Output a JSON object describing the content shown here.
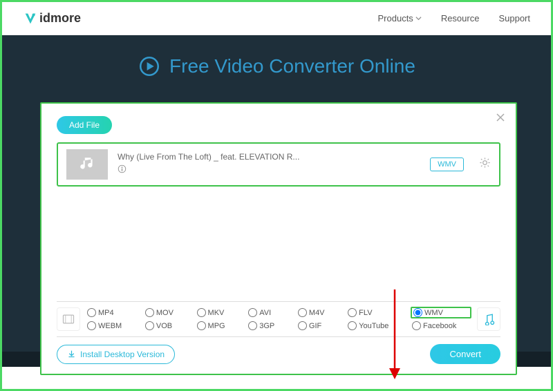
{
  "brand": "idmore",
  "nav": {
    "products": "Products",
    "resource": "Resource",
    "support": "Support"
  },
  "hero": {
    "title": "Free Video Converter Online"
  },
  "modal": {
    "add_file": "Add File",
    "file": {
      "name": "Why (Live From The Loft) _ feat. ELEVATION R...",
      "badge": "WMV"
    },
    "install": "Install Desktop Version",
    "convert": "Convert"
  },
  "formats": {
    "row1": [
      "MP4",
      "MOV",
      "MKV",
      "AVI",
      "M4V",
      "FLV",
      "WMV"
    ],
    "row2": [
      "WEBM",
      "VOB",
      "MPG",
      "3GP",
      "GIF",
      "YouTube",
      "Facebook"
    ],
    "selected": "WMV"
  }
}
